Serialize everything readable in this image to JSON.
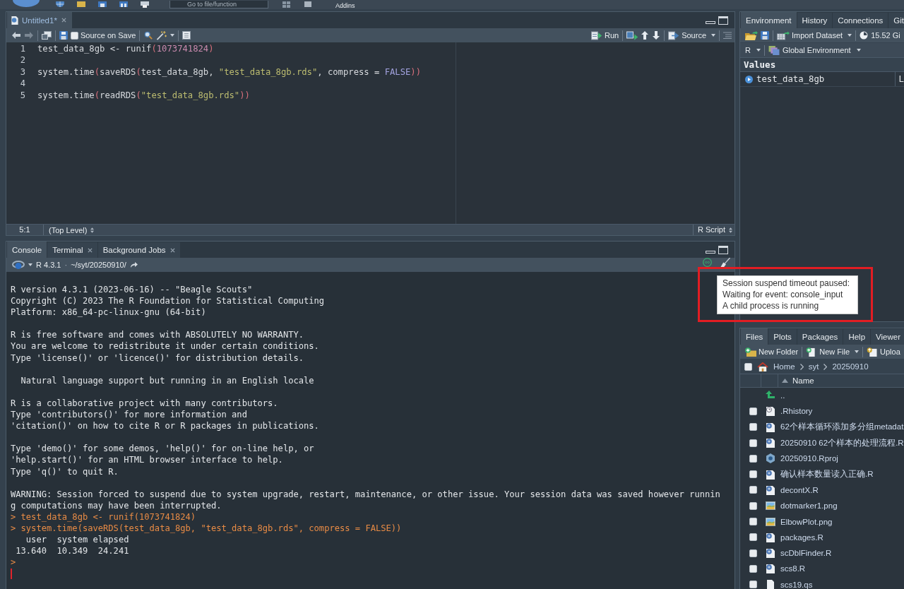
{
  "main_toolbar": {
    "search": {
      "placeholder": "Go to file/function"
    },
    "addins": "Addins"
  },
  "editor": {
    "tabs": [
      {
        "label": "Untitled1*",
        "selected": true,
        "closable": true
      }
    ],
    "toolbar": {
      "source_on_save": {
        "label": "Source on Save",
        "checked": false
      },
      "run": "Run",
      "source": "Source"
    },
    "lines": [
      {
        "number": "1",
        "tokens": [
          {
            "kind": "plain",
            "text": "test_data_8gb <- runif"
          },
          {
            "kind": "paren",
            "text": "("
          },
          {
            "kind": "number",
            "text": "1073741824"
          },
          {
            "kind": "paren",
            "text": ")"
          }
        ]
      },
      {
        "number": "2"
      },
      {
        "number": "3",
        "tokens": [
          {
            "kind": "plain",
            "text": "system.time"
          },
          {
            "kind": "paren",
            "text": "("
          },
          {
            "kind": "plain",
            "text": "saveRDS"
          },
          {
            "kind": "paren",
            "text": "("
          },
          {
            "kind": "plain",
            "text": "test_data_8gb, "
          },
          {
            "kind": "string",
            "text": "\"test_data_8gb.rds\""
          },
          {
            "kind": "plain",
            "text": ", compress = "
          },
          {
            "kind": "constant",
            "text": "FALSE"
          },
          {
            "kind": "paren",
            "text": "))"
          }
        ]
      },
      {
        "number": "4"
      },
      {
        "number": "5",
        "tokens": [
          {
            "kind": "plain",
            "text": "system.time"
          },
          {
            "kind": "paren",
            "text": "("
          },
          {
            "kind": "plain",
            "text": "readRDS"
          },
          {
            "kind": "paren",
            "text": "("
          },
          {
            "kind": "string",
            "text": "\"test_data_8gb.rds\""
          },
          {
            "kind": "paren",
            "text": "))"
          }
        ]
      }
    ],
    "status": {
      "position": "5:1",
      "scope": "(Top Level)",
      "file_type": "R Script"
    }
  },
  "console": {
    "tabs": [
      {
        "label": "Console",
        "selected": true,
        "closable": false
      },
      {
        "label": "Terminal",
        "selected": false,
        "closable": true
      },
      {
        "label": "Background Jobs",
        "selected": false,
        "closable": true
      }
    ],
    "version": "R 4.3.1",
    "separator": "·",
    "path": "~/syt/20250910/",
    "lines": [
      {
        "kind": "output",
        "text": "R version 4.3.1 (2023-06-16) -- \"Beagle Scouts\""
      },
      {
        "kind": "output",
        "text": "Copyright (C) 2023 The R Foundation for Statistical Computing"
      },
      {
        "kind": "output",
        "text": "Platform: x86_64-pc-linux-gnu (64-bit)"
      },
      {
        "kind": "blank"
      },
      {
        "kind": "output",
        "text": "R is free software and comes with ABSOLUTELY NO WARRANTY."
      },
      {
        "kind": "output",
        "text": "You are welcome to redistribute it under certain conditions."
      },
      {
        "kind": "output",
        "text": "Type 'license()' or 'licence()' for distribution details."
      },
      {
        "kind": "blank"
      },
      {
        "kind": "output",
        "text": "  Natural language support but running in an English locale"
      },
      {
        "kind": "blank"
      },
      {
        "kind": "output",
        "text": "R is a collaborative project with many contributors."
      },
      {
        "kind": "output",
        "text": "Type 'contributors()' for more information and"
      },
      {
        "kind": "output",
        "text": "'citation()' on how to cite R or R packages in publications."
      },
      {
        "kind": "blank"
      },
      {
        "kind": "output",
        "text": "Type 'demo()' for some demos, 'help()' for on-line help, or"
      },
      {
        "kind": "output",
        "text": "'help.start()' for an HTML browser interface to help."
      },
      {
        "kind": "output",
        "text": "Type 'q()' to quit R."
      },
      {
        "kind": "blank"
      },
      {
        "kind": "output",
        "text": "WARNING: Session forced to suspend due to system upgrade, restart, maintenance, or other issue. Your session data was saved however runnin"
      },
      {
        "kind": "output",
        "text": "g computations may have been interrupted."
      },
      {
        "kind": "input",
        "text": "> test_data_8gb <- runif(1073741824)"
      },
      {
        "kind": "input",
        "text": "> system.time(saveRDS(test_data_8gb, \"test_data_8gb.rds\", compress = FALSE))"
      },
      {
        "kind": "output",
        "text": "   user  system elapsed"
      },
      {
        "kind": "output",
        "text": " 13.640  10.349  24.241"
      },
      {
        "kind": "input",
        "text": ">"
      }
    ]
  },
  "tooltip": {
    "lines": [
      "Session suspend timeout paused:",
      "Waiting for event: console_input",
      "A child process is running"
    ]
  },
  "environment": {
    "tabs": [
      {
        "label": "Environment",
        "selected": true
      },
      {
        "label": "History",
        "selected": false
      },
      {
        "label": "Connections",
        "selected": false
      },
      {
        "label": "Git",
        "selected": false
      }
    ],
    "toolbar": {
      "import": "Import Dataset",
      "memory": "15.52 Gi",
      "language": "R",
      "scope": "Global Environment"
    },
    "section": "Values",
    "rows": [
      {
        "name": "test_data_8gb",
        "value": "L"
      }
    ]
  },
  "files": {
    "tabs": [
      {
        "label": "Files",
        "selected": true
      },
      {
        "label": "Plots",
        "selected": false
      },
      {
        "label": "Packages",
        "selected": false
      },
      {
        "label": "Help",
        "selected": false
      },
      {
        "label": "Viewer",
        "selected": false
      }
    ],
    "toolbar": {
      "new_folder": "New Folder",
      "new_file": "New File",
      "upload": "Uploa"
    },
    "select_all": {
      "checked": false
    },
    "breadcrumb": [
      "Home",
      "syt",
      "20250910"
    ],
    "column": "Name",
    "parent": "..",
    "rows": [
      {
        "kind": "history",
        "name": ".Rhistory",
        "checked": false
      },
      {
        "kind": "rscript",
        "name": "62个样本循环添加多分组metadat",
        "checked": false
      },
      {
        "kind": "rscript",
        "name": "20250910 62个样本的处理流程.R",
        "checked": false
      },
      {
        "kind": "rproj",
        "name": "20250910.Rproj",
        "checked": false
      },
      {
        "kind": "rscript",
        "name": "确认样本数量读入正确.R",
        "checked": false
      },
      {
        "kind": "rscript",
        "name": "decontX.R",
        "checked": false
      },
      {
        "kind": "image",
        "name": "dotmarker1.png",
        "checked": false
      },
      {
        "kind": "image",
        "name": "ElbowPlot.png",
        "checked": false
      },
      {
        "kind": "rscript",
        "name": "packages.R",
        "checked": false
      },
      {
        "kind": "rscript",
        "name": "scDblFinder.R",
        "checked": false
      },
      {
        "kind": "rscript",
        "name": "scs8.R",
        "checked": false
      },
      {
        "kind": "file",
        "name": "scs19.qs",
        "checked": false
      }
    ]
  }
}
